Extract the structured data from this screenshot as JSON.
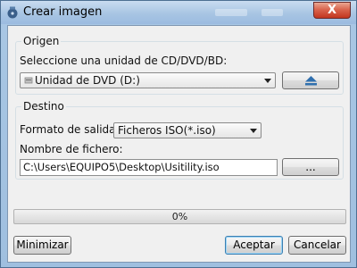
{
  "window": {
    "title": "Crear imagen",
    "close_glyph": "X",
    "app_icon": "disc-burner-icon"
  },
  "origen": {
    "group_label": "Origen",
    "drive_label": "Seleccione una  unidad de CD/DVD/BD:",
    "drive_value": "Unidad de DVD (D:)",
    "drive_icon": "dvd-drive-icon",
    "eject_icon": "eject-icon"
  },
  "destino": {
    "group_label": "Destino",
    "format_label": "Formato de salida:",
    "format_value": "Ficheros ISO(*.iso)",
    "filename_label": "Nombre de fichero:",
    "filename_value": "C:\\Users\\EQUIPO5\\Desktop\\Usitility.iso",
    "browse_label": "..."
  },
  "progress": {
    "value": 0,
    "text": "0%"
  },
  "buttons": {
    "minimize": "Minimizar",
    "accept": "Aceptar",
    "cancel": "Cancelar"
  },
  "colors": {
    "title_bar": "#a8c5e3",
    "close_button": "#c2361f",
    "progress_fill": "#3fbf3f",
    "dialog_background": "#f0f0f0"
  }
}
